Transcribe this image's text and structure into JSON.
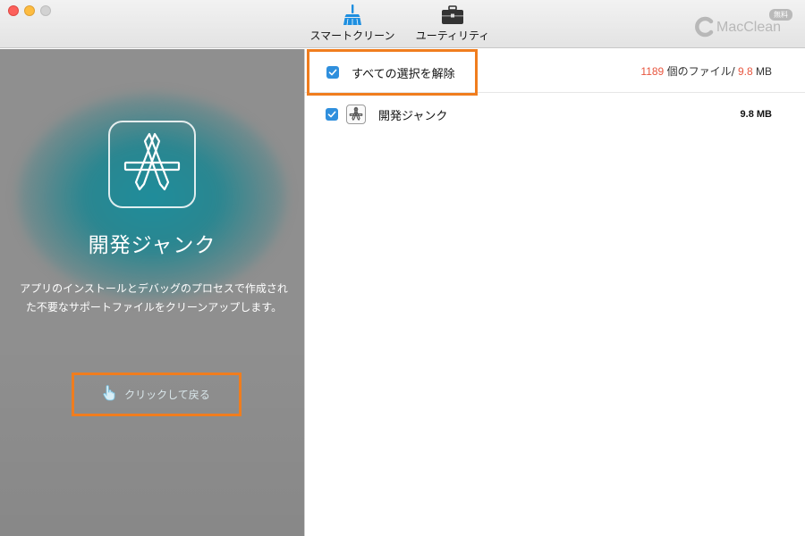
{
  "toolbar": {
    "tabs": [
      {
        "label": "スマートクリーン",
        "icon": "broom-icon"
      },
      {
        "label": "ユーティリティ",
        "icon": "toolbox-icon"
      }
    ],
    "brand": {
      "badge": "無料",
      "name": "MacClean"
    }
  },
  "left_panel": {
    "icon": "app-store-dev-icon",
    "title": "開発ジャンク",
    "description": "アプリのインストールとデバッグのプロセスで作成された不要なサポートファイルをクリーンアップします。",
    "back_button": {
      "label": "クリックして戻る",
      "icon": "hand-pointer-icon"
    }
  },
  "right_panel": {
    "select_all": {
      "label": "すべての選択を解除",
      "checked": true
    },
    "summary": {
      "file_count": "1189",
      "file_unit": "個のファイル/",
      "size_value": "9.8",
      "size_unit": "MB"
    },
    "items": [
      {
        "label": "開発ジャンク",
        "size": "9.8 MB",
        "checked": true,
        "icon": "app-store-dev-icon"
      }
    ]
  },
  "colors": {
    "accent_highlight": "#f07d1e",
    "checkbox_blue": "#2f8fdd",
    "count_red": "#e8563f",
    "panel_teal": "#1f8d9b"
  }
}
